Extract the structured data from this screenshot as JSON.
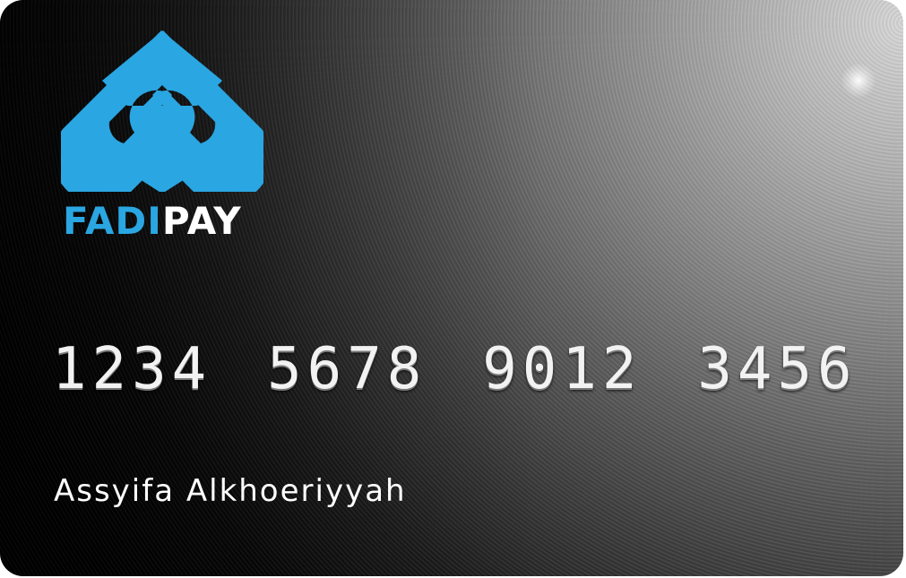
{
  "card": {
    "brand_part1": "FADI",
    "brand_part2": "PAY",
    "logo_icon": "fp-monogram-icon",
    "number_groups": [
      "1234",
      "5678",
      "9012",
      "3456"
    ],
    "holder_name": "Assyifa Alkhoeriyyah"
  },
  "colors": {
    "brand_blue": "#2aa6e2",
    "text_white": "#ffffff"
  }
}
